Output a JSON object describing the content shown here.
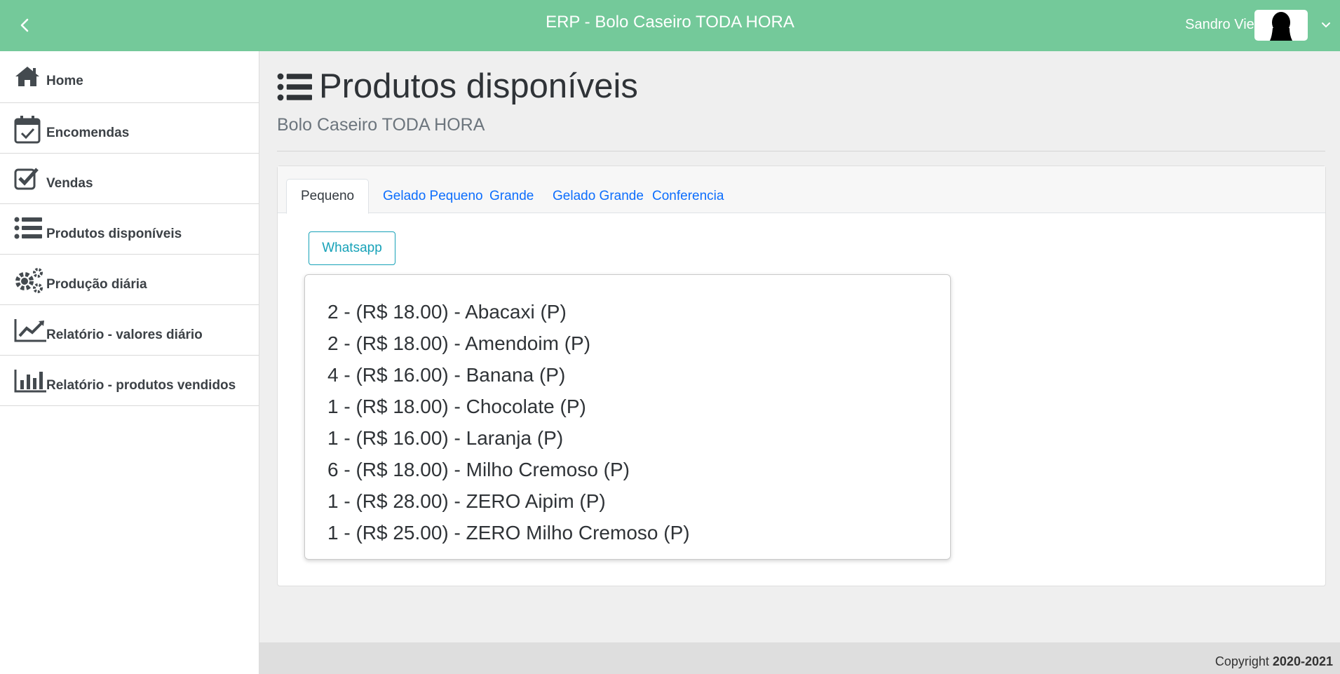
{
  "header": {
    "title": "ERP - Bolo Caseiro TODA HORA",
    "user_name": "Sandro Vieira",
    "back_icon": "chevron-left-icon",
    "menu_icon": "chevron-down-icon",
    "bg_color": "#74c99a"
  },
  "sidebar": {
    "items": [
      {
        "label": "Home",
        "icon": "home-icon"
      },
      {
        "label": "Encomendas",
        "icon": "calendar-check-icon"
      },
      {
        "label": "Vendas",
        "icon": "check-square-icon"
      },
      {
        "label": "Produtos disponíveis",
        "icon": "list-icon"
      },
      {
        "label": "Produção diária",
        "icon": "gears-icon"
      },
      {
        "label": "Relatório - valores diário",
        "icon": "line-chart-icon"
      },
      {
        "label": "Relatório - produtos vendidos",
        "icon": "bar-chart-icon"
      }
    ]
  },
  "page": {
    "title": "Produtos disponíveis",
    "subtitle": "Bolo Caseiro TODA HORA"
  },
  "tabs": [
    {
      "label": "Pequeno",
      "active": true
    },
    {
      "label": "Gelado Pequeno",
      "active": false
    },
    {
      "label": "Grande",
      "active": false
    },
    {
      "label": "Gelado Grande",
      "active": false
    },
    {
      "label": "Conferencia",
      "active": false
    }
  ],
  "whatsapp_label": "Whatsapp",
  "products": [
    "2 - (R$ 18.00) - Abacaxi (P)",
    "2 - (R$ 18.00) - Amendoim (P)",
    "4 - (R$ 16.00) - Banana (P)",
    "1 - (R$ 18.00) - Chocolate (P)",
    "1 - (R$ 16.00) - Laranja (P)",
    "6 - (R$ 18.00) - Milho Cremoso (P)",
    "1 - (R$ 28.00) - ZERO Aipim (P)",
    "1 - (R$ 25.00) - ZERO Milho Cremoso (P)"
  ],
  "footer": {
    "copyright_label": "Copyright",
    "years": "2020-2021"
  }
}
